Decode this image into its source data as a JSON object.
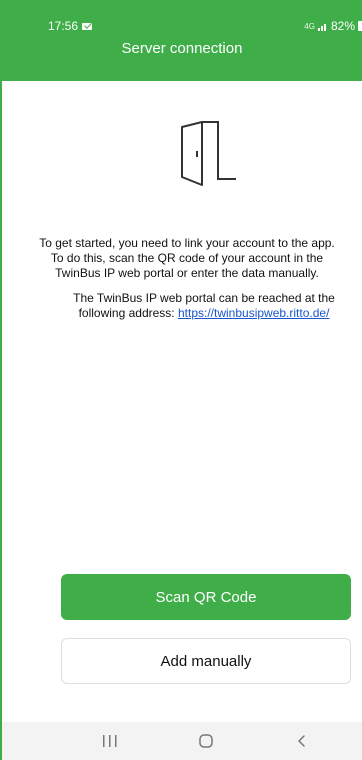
{
  "status_bar": {
    "time": "17:56",
    "network": "4G",
    "battery": "82%"
  },
  "header": {
    "title": "Server connection"
  },
  "content": {
    "intro_lines": [
      "To get started, you need to link your account to the app.",
      "To do this, scan the QR code of your account in the",
      "TwinBus IP web portal or enter the data manually."
    ],
    "portal_lines": [
      "The TwinBus IP web portal can be reached at the",
      "following address:"
    ],
    "portal_link": "https://twinbusipweb.ritto.de/"
  },
  "buttons": {
    "scan_label": "Scan QR Code",
    "manual_label": "Add manually"
  },
  "icons": {
    "door": "door-open-icon",
    "recents": "recents-icon",
    "home": "home-icon",
    "back": "back-icon"
  },
  "colors": {
    "accent": "#3fae49",
    "link": "#1a55cc",
    "navbar": "#f3f3f3"
  }
}
